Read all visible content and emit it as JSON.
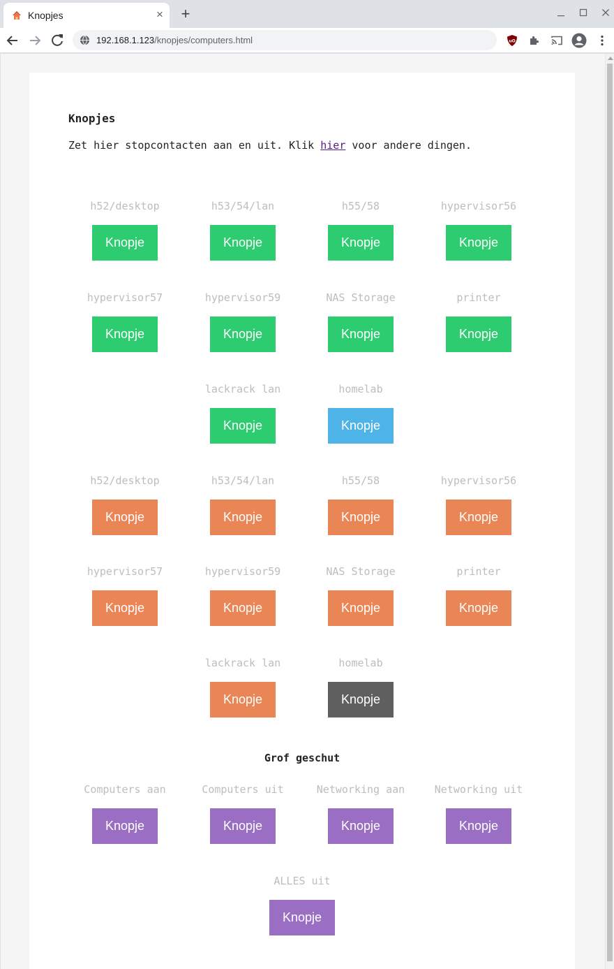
{
  "browser": {
    "tab_title": "Knopjes",
    "url_host": "192.168.1.123",
    "url_path": "/knopjes/computers.html",
    "new_tab_symbol": "+",
    "tab_close_symbol": "×"
  },
  "page": {
    "heading": "Knopjes",
    "intro_before": "Zet hier stopcontacten aan en uit. Klik ",
    "intro_link": "hier",
    "intro_after": " voor andere dingen.",
    "section_heading": "Grof geschut"
  },
  "button_label": "Knopje",
  "colors": {
    "on": "#2ecc71",
    "on_active": "#4eb3e6",
    "off": "#ea8656",
    "off_active": "#5f5f5f",
    "bulk": "#9a6fc3"
  },
  "on_group": [
    {
      "label": "h52/desktop",
      "state": "green",
      "button": "Knopje"
    },
    {
      "label": "h53/54/lan",
      "state": "green",
      "button": "Knopje"
    },
    {
      "label": "h55/58",
      "state": "green",
      "button": "Knopje"
    },
    {
      "label": "hypervisor56",
      "state": "green",
      "button": "Knopje"
    },
    {
      "label": "hypervisor57",
      "state": "green",
      "button": "Knopje"
    },
    {
      "label": "hypervisor59",
      "state": "green",
      "button": "Knopje"
    },
    {
      "label": "NAS Storage",
      "state": "green",
      "button": "Knopje"
    },
    {
      "label": "printer",
      "state": "green",
      "button": "Knopje"
    },
    {
      "label": "lackrack lan",
      "state": "green",
      "button": "Knopje"
    },
    {
      "label": "homelab",
      "state": "blue",
      "button": "Knopje"
    }
  ],
  "off_group": [
    {
      "label": "h52/desktop",
      "state": "orange",
      "button": "Knopje"
    },
    {
      "label": "h53/54/lan",
      "state": "orange",
      "button": "Knopje"
    },
    {
      "label": "h55/58",
      "state": "orange",
      "button": "Knopje"
    },
    {
      "label": "hypervisor56",
      "state": "orange",
      "button": "Knopje"
    },
    {
      "label": "hypervisor57",
      "state": "orange",
      "button": "Knopje"
    },
    {
      "label": "hypervisor59",
      "state": "orange",
      "button": "Knopje"
    },
    {
      "label": "NAS Storage",
      "state": "orange",
      "button": "Knopje"
    },
    {
      "label": "printer",
      "state": "orange",
      "button": "Knopje"
    },
    {
      "label": "lackrack lan",
      "state": "orange",
      "button": "Knopje"
    },
    {
      "label": "homelab",
      "state": "grey",
      "button": "Knopje"
    }
  ],
  "bulk_group": [
    {
      "label": "Computers aan",
      "state": "purple",
      "button": "Knopje"
    },
    {
      "label": "Computers uit",
      "state": "purple",
      "button": "Knopje"
    },
    {
      "label": "Networking aan",
      "state": "purple",
      "button": "Knopje"
    },
    {
      "label": "Networking uit",
      "state": "purple",
      "button": "Knopje"
    },
    {
      "label": "ALLES uit",
      "state": "purple",
      "button": "Knopje"
    }
  ]
}
